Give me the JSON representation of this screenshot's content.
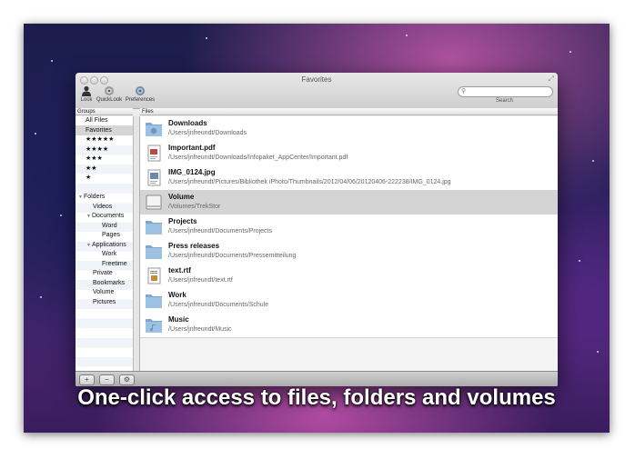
{
  "window": {
    "title": "Favorites"
  },
  "toolbar": {
    "lock_label": "Lock",
    "quicklook_label": "QuickLook",
    "preferences_label": "Preferences",
    "search_placeholder": "",
    "search_label": "Search"
  },
  "headers": {
    "groups": "Groups",
    "files": "Files"
  },
  "sidebar": {
    "items": [
      {
        "label": "All Files"
      },
      {
        "label": "Favorites"
      },
      {
        "label": "★★★★★"
      },
      {
        "label": "★★★★"
      },
      {
        "label": "★★★"
      },
      {
        "label": "★★"
      },
      {
        "label": "★"
      },
      {
        "label": "Folders"
      },
      {
        "label": "Videos"
      },
      {
        "label": "Documents"
      },
      {
        "label": "Word"
      },
      {
        "label": "Pages"
      },
      {
        "label": "Applications"
      },
      {
        "label": "Work"
      },
      {
        "label": "Freetime"
      },
      {
        "label": "Private"
      },
      {
        "label": "Bookmarks"
      },
      {
        "label": "Volume"
      },
      {
        "label": "Pictures"
      }
    ],
    "selected": "Favorites"
  },
  "files": [
    {
      "name": "Downloads",
      "path": "/Users/jnfreundt/Downloads",
      "icon": "downloads-folder-icon"
    },
    {
      "name": "Important.pdf",
      "path": "/Users/jnfreundt/Downloads/Infopaket_AppCenter/Important.pdf",
      "icon": "pdf-file-icon"
    },
    {
      "name": "IMG_0124.jpg",
      "path": "/Users/jnfreundt/Pictures/Bibliothek iPhoto/Thumbnails/2012/04/06/20120406-222238/IMG_0124.jpg",
      "icon": "image-file-icon"
    },
    {
      "name": "Volume",
      "path": "/Volumes/TrekStor",
      "icon": "drive-icon"
    },
    {
      "name": "Projects",
      "path": "/Users/jnfreundt/Documents/Projects",
      "icon": "folder-icon"
    },
    {
      "name": "Press releases",
      "path": "/Users/jnfreundt/Documents/Pressemitteilung",
      "icon": "folder-icon"
    },
    {
      "name": "text.rtf",
      "path": "/Users/jnfreundt/text.rtf",
      "icon": "rtf-file-icon"
    },
    {
      "name": "Work",
      "path": "/Users/jnfreundt/Documents/Schule",
      "icon": "folder-icon"
    },
    {
      "name": "Music",
      "path": "/Users/jnfreundt/Music",
      "icon": "music-folder-icon"
    }
  ],
  "selected_file": "Volume",
  "bottombar": {
    "add": "+",
    "remove": "−",
    "action": "⚙"
  },
  "caption": "One-click access to files, folders and volumes"
}
